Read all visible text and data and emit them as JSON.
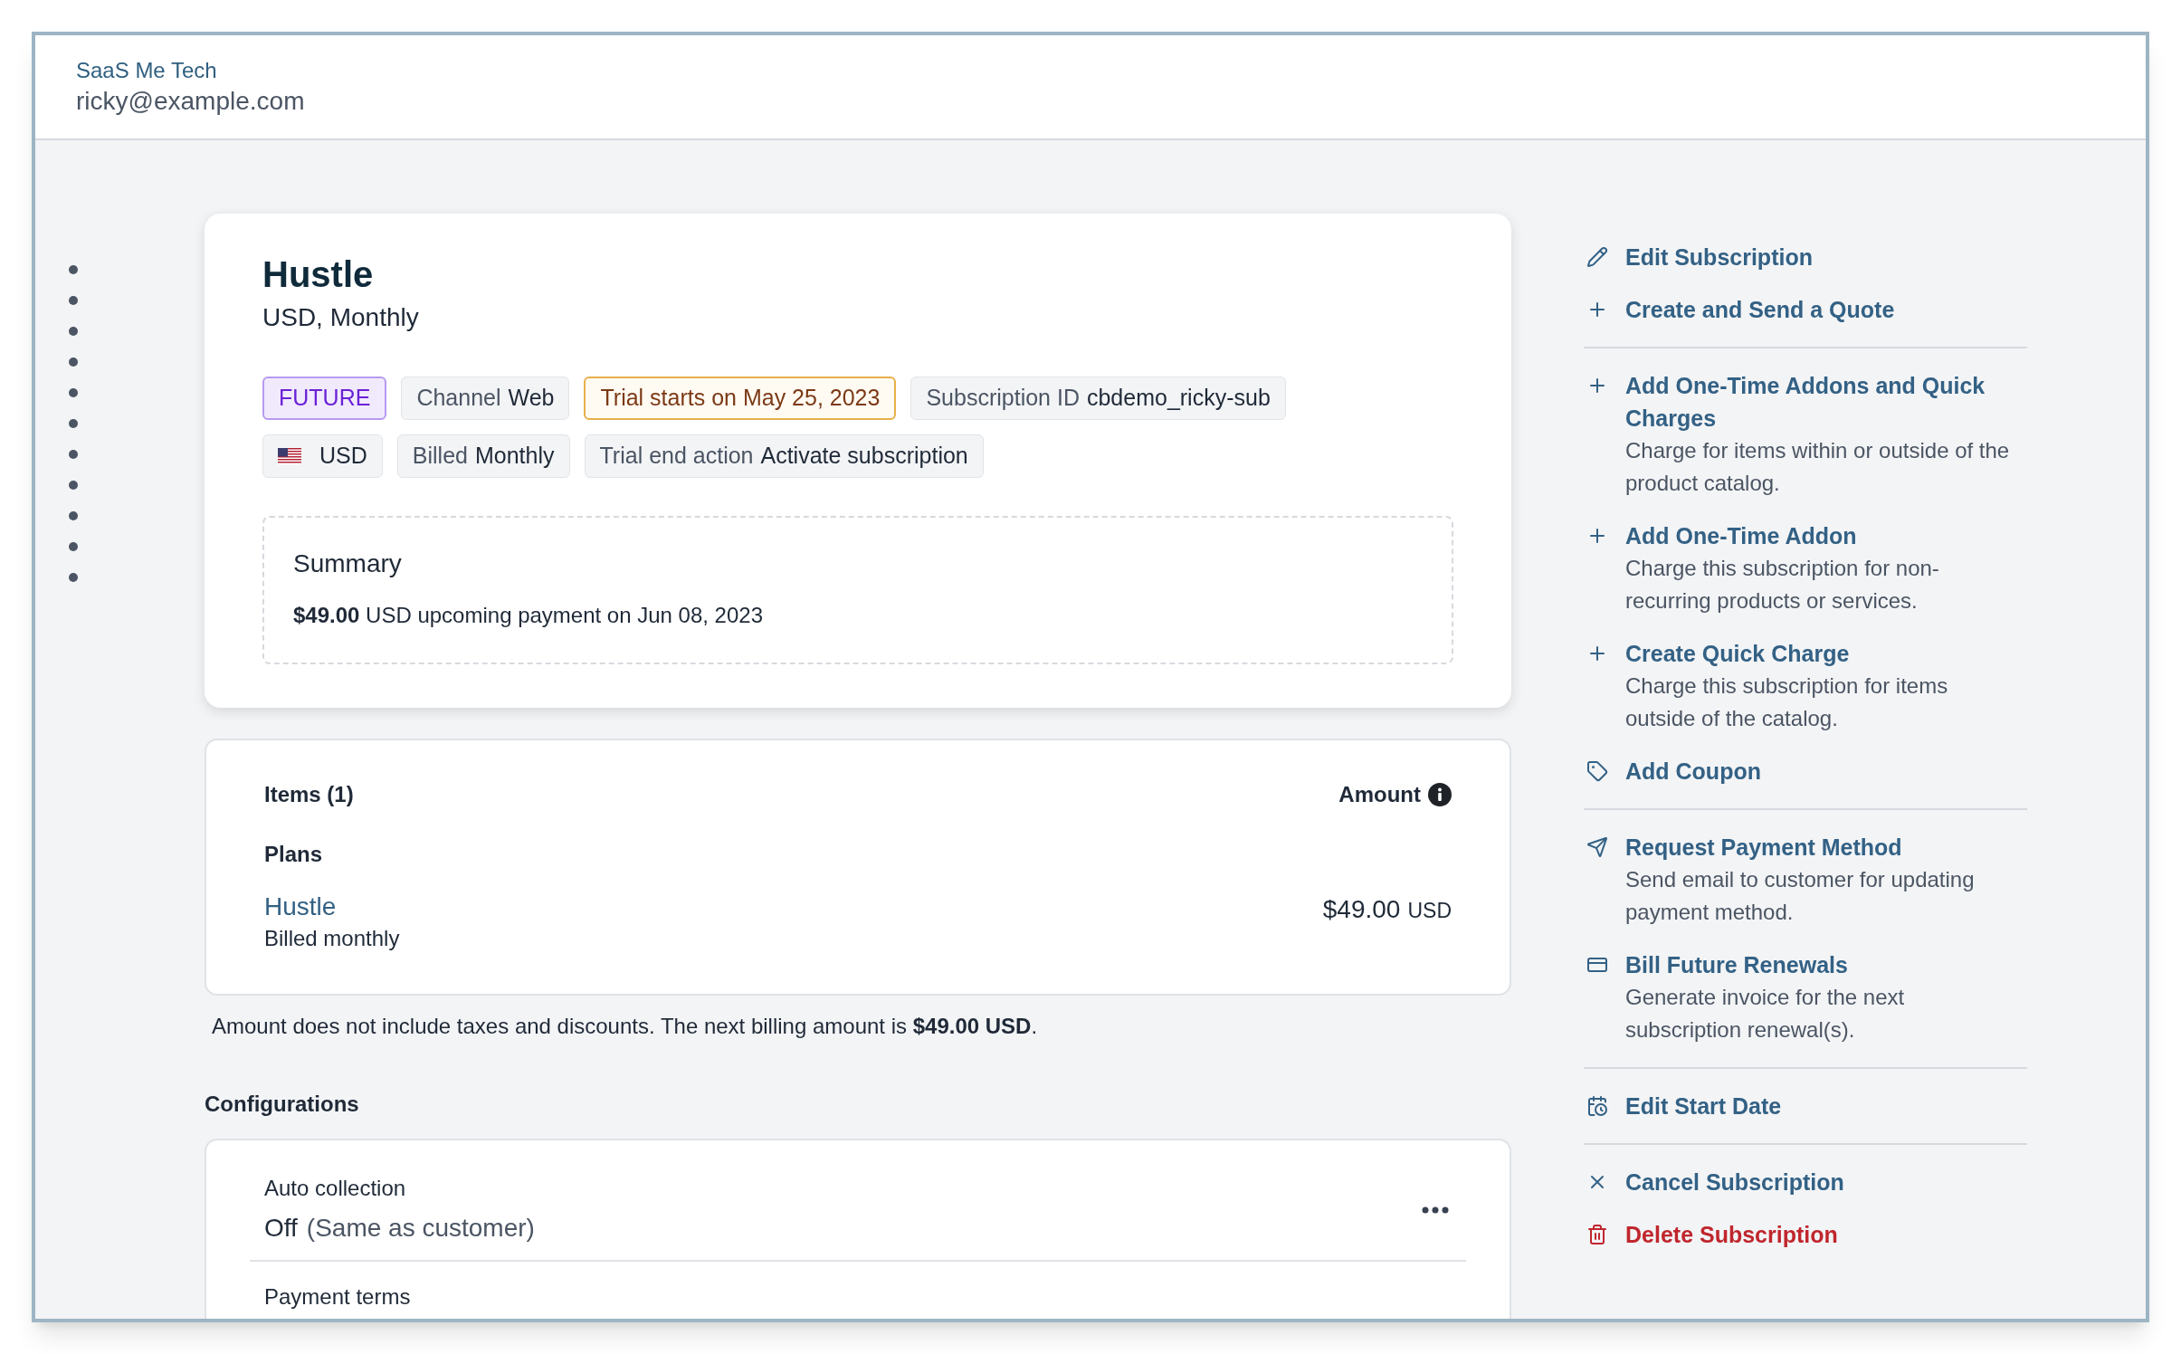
{
  "header": {
    "company": "SaaS Me Tech",
    "email": "ricky@example.com"
  },
  "subscription": {
    "title": "Hustle",
    "subtitle": "USD, Monthly",
    "badges": [
      {
        "kind": "status",
        "value": "FUTURE"
      },
      {
        "kind": "plain",
        "label": "Channel",
        "value": "Web"
      },
      {
        "kind": "trial",
        "value": "Trial starts on May 25, 2023"
      },
      {
        "kind": "plain",
        "label": "Subscription ID",
        "value": "cbdemo_ricky-sub"
      },
      {
        "kind": "currency",
        "value": "USD"
      },
      {
        "kind": "plain",
        "label": "Billed",
        "value": "Monthly"
      },
      {
        "kind": "plain",
        "label": "Trial end action",
        "value": "Activate subscription"
      }
    ],
    "summary": {
      "title": "Summary",
      "text": "**$49.00** USD upcoming payment on Jun 08, 2023"
    }
  },
  "items": {
    "heading": "Items (1)",
    "amount_heading": "Amount",
    "section": "Plans",
    "rows": [
      {
        "name": "Hustle",
        "billing": "Billed monthly",
        "price": "$49.00",
        "currency": "USD"
      }
    ],
    "note": "Amount does not include taxes and discounts. The next billing amount is **$49.00 USD**."
  },
  "configurations": {
    "heading": "Configurations",
    "rows": [
      {
        "label": "Auto collection",
        "value": "Off",
        "note": "(Same as customer)"
      },
      {
        "label": "Payment terms"
      }
    ]
  },
  "actions": [
    [
      {
        "kind": "edit",
        "title": "Edit Subscription"
      },
      {
        "kind": "add",
        "title": "Create and Send a Quote"
      }
    ],
    [
      {
        "kind": "add",
        "title": "Add One-Time Addons and Quick Charges",
        "description": "Charge for items within or outside of the product catalog."
      },
      {
        "kind": "add",
        "title": "Add One-Time Addon",
        "description": "Charge this subscription for non-recurring products or services."
      },
      {
        "kind": "add",
        "title": "Create Quick Charge",
        "description": "Charge this subscription for items outside of the catalog."
      },
      {
        "kind": "coupon",
        "title": "Add Coupon"
      }
    ],
    [
      {
        "kind": "request",
        "title": "Request Payment Method",
        "description": "Send email to customer for updating payment method."
      },
      {
        "kind": "bill",
        "title": "Bill Future Renewals",
        "description": "Generate invoice for the next subscription renewal(s)."
      }
    ],
    [
      {
        "kind": "date",
        "title": "Edit Start Date"
      }
    ],
    [
      {
        "kind": "cancel",
        "title": "Cancel Subscription"
      },
      {
        "kind": "delete",
        "title": "Delete Subscription"
      }
    ]
  ]
}
